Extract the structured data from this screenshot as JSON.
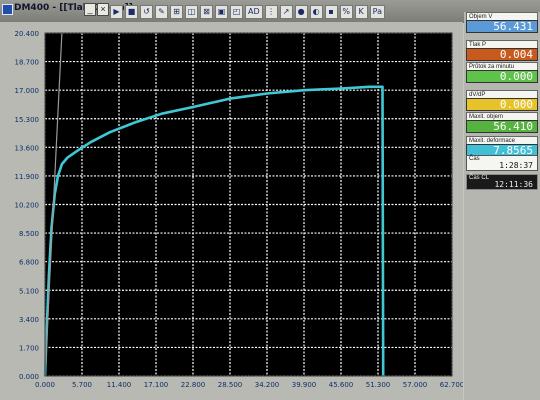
{
  "window": {
    "title": "DM400 - [[Tlak/Objem]]",
    "buttons": {
      "minimize": "_",
      "maximize": "□",
      "close": "×"
    }
  },
  "toolbar": {
    "items": [
      "▶",
      "■",
      "↺",
      "✎",
      "⊞",
      "◫",
      "⊠",
      "▣",
      "◰",
      "AD",
      "⋮",
      "↗",
      "●",
      "◐",
      "▪",
      "%",
      "K",
      "Pa"
    ]
  },
  "readouts": [
    {
      "label": "Objem V",
      "value": "56.431",
      "color": "#5b9ad6",
      "text_color": "#ffffff"
    },
    {
      "label": "Tlak P",
      "value": "0.004",
      "color": "#c95a1e",
      "text_color": "#ffffff"
    },
    {
      "label": "Průtok za minutu",
      "value": "0.000",
      "color": "#5fc24a",
      "text_color": "#ffffff"
    },
    {
      "label": "dV/dP",
      "value": "0.000",
      "color": "#e6c32a",
      "text_color": "#ffffff"
    },
    {
      "label": "Maxit. objem",
      "value": "56.410",
      "color": "#57b33f",
      "text_color": "#ffffff"
    },
    {
      "label": "Maxit. deformace",
      "value": "7.8565",
      "color": "#40bfd6",
      "text_color": "#ffffff"
    }
  ],
  "times": [
    {
      "label": "Čas",
      "value": "1:28:37",
      "style": "light"
    },
    {
      "label": "Čas CL",
      "value": "12:11:36",
      "style": "dark"
    }
  ],
  "chart_data": {
    "type": "line",
    "xlabel": "",
    "ylabel": "",
    "xlim": [
      0,
      62.7
    ],
    "ylim": [
      0,
      20.4
    ],
    "x_ticks": [
      "0.000",
      "5.700",
      "11.400",
      "17.100",
      "22.800",
      "28.500",
      "34.200",
      "39.900",
      "45.600",
      "51.300",
      "57.000",
      "62.700"
    ],
    "y_ticks": [
      "0.000",
      "1.700",
      "3.400",
      "5.100",
      "6.800",
      "8.500",
      "10.200",
      "11.900",
      "13.600",
      "15.300",
      "17.000",
      "18.700",
      "20.400"
    ],
    "grid": true,
    "background": "#000000",
    "grid_color": "#ffffff",
    "series": [
      {
        "color": "#40c9d4",
        "x": [
          0.0,
          0.3,
          0.6,
          1.0,
          1.5,
          2.0,
          2.6,
          3.5,
          5.0,
          7.0,
          10.0,
          14.0,
          18.0,
          22.8,
          28.5,
          34.2,
          39.9,
          45.6,
          50.0,
          52.0,
          52.1
        ],
        "y": [
          0.0,
          3.0,
          6.0,
          8.8,
          10.8,
          11.9,
          12.6,
          13.0,
          13.4,
          13.9,
          14.5,
          15.1,
          15.6,
          16.0,
          16.5,
          16.8,
          17.0,
          17.1,
          17.2,
          17.2,
          0.0
        ]
      },
      {
        "color": "#9a9a9a",
        "x": [
          0.0,
          1.3,
          2.6
        ],
        "y": [
          0.0,
          10.2,
          20.4
        ]
      }
    ]
  }
}
